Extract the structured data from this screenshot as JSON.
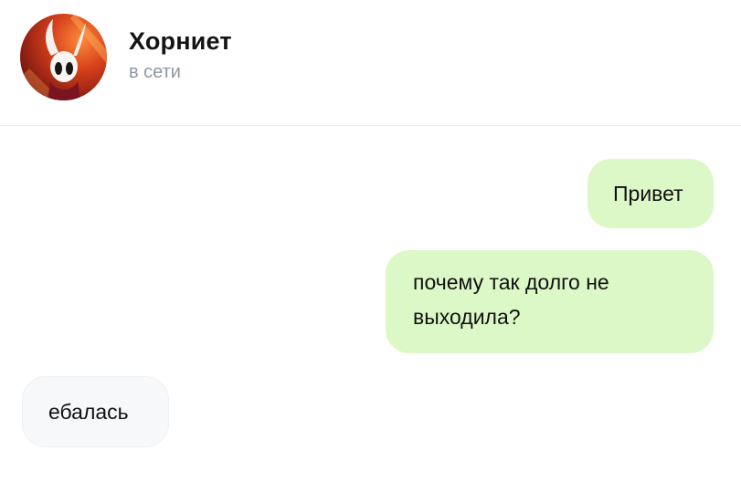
{
  "contact": {
    "name": "Хорниет",
    "status": "в сети",
    "avatar_icon": "hornet-character-avatar"
  },
  "colors": {
    "outgoing_bubble": "#dcf8c7",
    "incoming_bubble": "#f7f8fa",
    "status_text": "#8e96a3"
  },
  "messages": [
    {
      "direction": "outgoing",
      "text": "Привет"
    },
    {
      "direction": "outgoing",
      "text": "почему так долго не выходила?"
    },
    {
      "direction": "incoming",
      "text": "ебалась"
    }
  ]
}
